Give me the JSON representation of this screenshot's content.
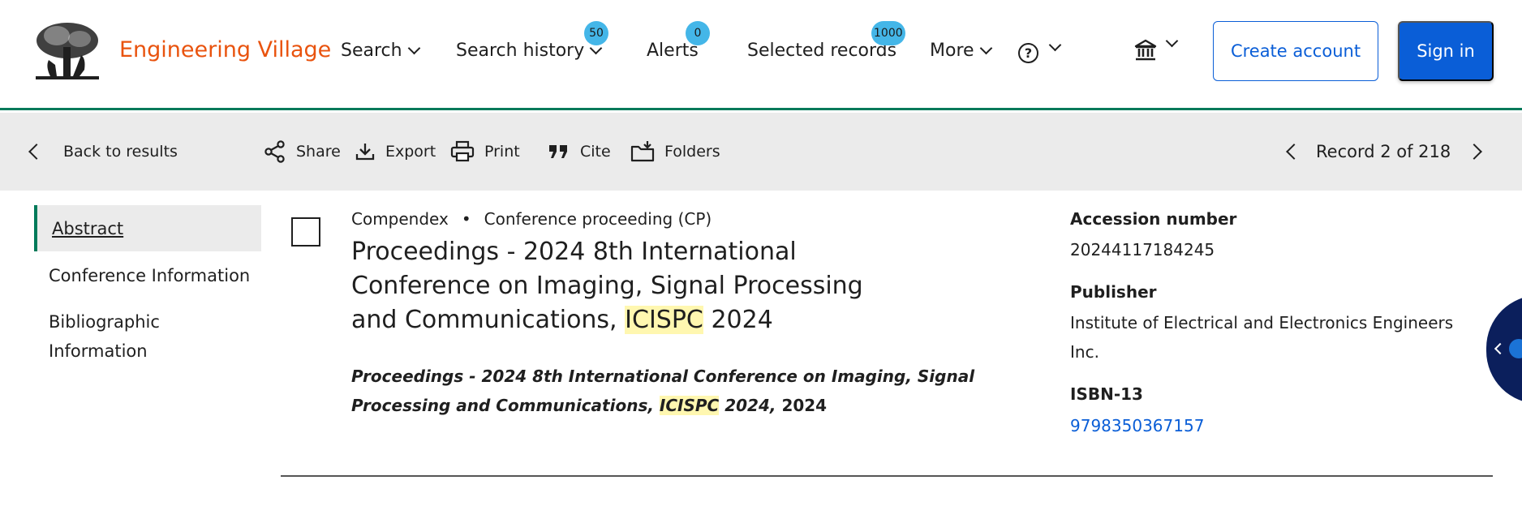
{
  "header": {
    "brand": "Engineering Village",
    "nav": {
      "search": "Search",
      "search_history": "Search history",
      "search_history_count": "50",
      "alerts": "Alerts",
      "alerts_count": "0",
      "selected_records": "Selected records",
      "selected_records_count": "1000",
      "more": "More"
    },
    "help_glyph": "?",
    "create_account": "Create account",
    "sign_in": "Sign in"
  },
  "toolbar": {
    "back": "Back to results",
    "share": "Share",
    "export": "Export",
    "print": "Print",
    "cite": "Cite",
    "folders": "Folders",
    "record_label": "Record 2 of 218"
  },
  "sidebar": {
    "items": [
      {
        "label": "Abstract"
      },
      {
        "label": "Conference Information"
      },
      {
        "label": "Bibliographic Information"
      }
    ]
  },
  "record": {
    "database": "Compendex",
    "doc_type": "Conference proceeding (CP)",
    "title_before": "Proceedings - 2024 8th International Conference on Imaging, Signal Processing and Communications,",
    "title_highlight": "ICISPC",
    "title_after": "2024",
    "source_before": "Proceedings - 2024 8th International Conference on Imaging, Signal Processing and Communications,",
    "source_highlight": "ICISPC",
    "source_after": "2024,",
    "source_year": "2024"
  },
  "details": {
    "accession_label": "Accession number",
    "accession_value": "20244117184245",
    "publisher_label": "Publisher",
    "publisher_value": "Institute of Electrical and Electronics Engineers Inc.",
    "isbn_label": "ISBN-13",
    "isbn_value": "9798350367157"
  },
  "colors": {
    "brand": "#e9530e",
    "accent": "#0a5ed7",
    "active_border": "#007a5a",
    "badge": "#44b6e8",
    "highlight": "#fff7b0"
  }
}
